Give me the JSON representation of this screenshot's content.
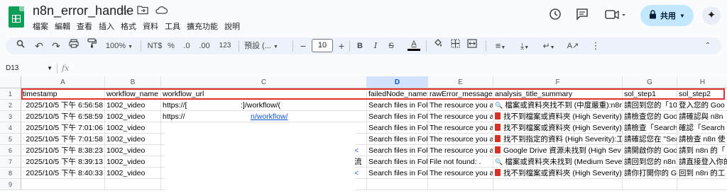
{
  "app": {
    "title": "n8n_error_handle",
    "menu": [
      "檔案",
      "編輯",
      "查看",
      "插入",
      "格式",
      "資料",
      "工具",
      "擴充功能",
      "說明"
    ],
    "share_label": "共用"
  },
  "toolbar": {
    "zoom": "100%",
    "currency": "NT$",
    "percent": "%",
    "dec_dec": ".0",
    "dec_inc": ".00",
    "number_format": "123",
    "font": "預設 (...",
    "font_size": "10",
    "bold": "B",
    "italic": "I",
    "strike": "S",
    "textcolor": "A"
  },
  "formula_bar": {
    "cell_ref": "D13",
    "fx": "fx"
  },
  "grid": {
    "columns": [
      "A",
      "B",
      "C",
      "D",
      "E",
      "F",
      "G",
      "H"
    ],
    "selected_column": "D",
    "row_numbers": [
      "1",
      "2",
      "3",
      "4",
      "5",
      "6",
      "7",
      "8",
      "9"
    ],
    "header_row": [
      "timestamp",
      "workflow_name",
      "workflow_url",
      "failedNode_name",
      "rawError_message",
      "analysis_title_summary",
      "sol_step1",
      "sol_step2"
    ],
    "rows": [
      {
        "a": "2025/10/5 下午 6:56:58",
        "b": "1002_video",
        "c": "https://[",
        "c2": ":]/workflow/(",
        "d": "Search files in Fol",
        "e": "The resource you ar",
        "f": "檔案或資料夾找不到 (中度嚴重):n8n",
        "f_icon": "search",
        "g": "請回到您的「10€",
        "h": "登入您的 Goo"
      },
      {
        "a": "2025/10/5 下午 6:58:59",
        "b": "1002_video",
        "c": "https://",
        "c2": "n/workflow/",
        "d": "Search files in Fol",
        "e": "The resource you ar",
        "f": "找不到檔案或資料夾 (High Severity)",
        "f_icon": "red",
        "g": "請檢查您的 Goo",
        "h": "請確認與 n8n"
      },
      {
        "a": "2025/10/5 下午 7:01:06",
        "b": "1002_video",
        "c": "",
        "c2": "",
        "d": "Search files in Fol",
        "e": "The resource you ar",
        "f": "找不到檔案或資料夾 (High Severity)",
        "f_icon": "red",
        "g": "請檢查「Search",
        "h": "確認「Search"
      },
      {
        "a": "2025/10/5 下午 7:01:58",
        "b": "1002_video",
        "c": "",
        "c2": "",
        "d": "Search files in Fol",
        "e": "The resource you ar",
        "f": "找不到指定的資料 (High Severity):工",
        "f_icon": "red",
        "g": "請確認您在 \"Sea",
        "h": "請檢查 n8n 使"
      },
      {
        "a": "2025/10/5 下午 8:38:23",
        "b": "1002_video",
        "c": "",
        "c2": "<",
        "d": "Search files in Fol",
        "e": "The resource you ar",
        "f": "Google Drive 資源未找到 (High Sev",
        "f_icon": "red",
        "g": "請開啟你的 Goo",
        "h": "請到 n8n 的「"
      },
      {
        "a": "2025/10/5 下午 8:39:13",
        "b": "1002_video",
        "c": "",
        "c2": "流",
        "d": "Search files in Fol",
        "e": "File not found: .",
        "f": "檔案或資料夾未找到 (Medium Sever",
        "f_icon": "search",
        "g": "請回到您的 n8n",
        "h": "請直接登入你的"
      },
      {
        "a": "2025/10/5 下午 8:40:33",
        "b": "1002_video",
        "c": "",
        "c2": "<",
        "d": "Search files in Fol",
        "e": "The resource you ar",
        "f": "找不到檔案或資料夾 (High Severity)",
        "f_icon": "red",
        "g": "請你打開你的 Go",
        "h": "回到 n8n 的工"
      }
    ]
  },
  "colors": {
    "highlight_border": "#e03131",
    "selected_col_bg": "#d3e3fd",
    "link": "#1155cc",
    "share_bg": "#c2e7ff"
  }
}
